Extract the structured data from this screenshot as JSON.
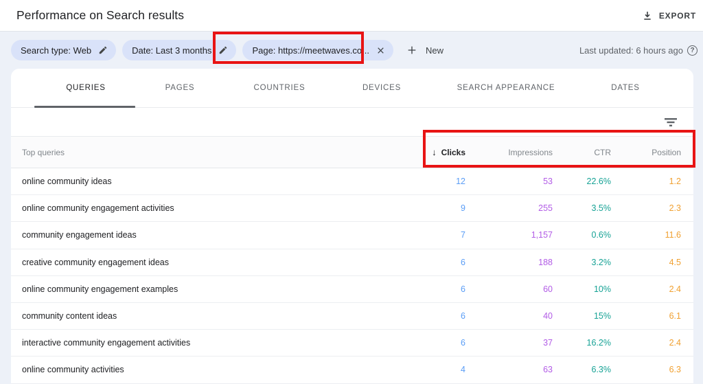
{
  "topbar": {
    "title": "Performance on Search results",
    "export_label": "EXPORT"
  },
  "filter_bar": {
    "chip_search_type": "Search type: Web",
    "chip_date": "Date: Last 3 months",
    "chip_page": "Page: https://meetwaves.co...",
    "new_label": "New",
    "last_updated": "Last updated: 6 hours ago"
  },
  "tabs": [
    {
      "label": "QUERIES",
      "active": true
    },
    {
      "label": "PAGES",
      "active": false
    },
    {
      "label": "COUNTRIES",
      "active": false
    },
    {
      "label": "DEVICES",
      "active": false
    },
    {
      "label": "SEARCH APPEARANCE",
      "active": false
    },
    {
      "label": "DATES",
      "active": false
    }
  ],
  "table": {
    "first_col_header": "Top queries",
    "sort_arrow": "↓",
    "sorted_column": "Clicks",
    "columns": [
      {
        "label": "Clicks"
      },
      {
        "label": "Impressions"
      },
      {
        "label": "CTR"
      },
      {
        "label": "Position"
      }
    ],
    "rows": [
      {
        "query": "online community ideas",
        "clicks": "12",
        "impressions": "53",
        "ctr": "22.6%",
        "position": "1.2"
      },
      {
        "query": "online community engagement activities",
        "clicks": "9",
        "impressions": "255",
        "ctr": "3.5%",
        "position": "2.3"
      },
      {
        "query": "community engagement ideas",
        "clicks": "7",
        "impressions": "1,157",
        "ctr": "0.6%",
        "position": "11.6"
      },
      {
        "query": "creative community engagement ideas",
        "clicks": "6",
        "impressions": "188",
        "ctr": "3.2%",
        "position": "4.5"
      },
      {
        "query": "online community engagement examples",
        "clicks": "6",
        "impressions": "60",
        "ctr": "10%",
        "position": "2.4"
      },
      {
        "query": "community content ideas",
        "clicks": "6",
        "impressions": "40",
        "ctr": "15%",
        "position": "6.1"
      },
      {
        "query": "interactive community engagement activities",
        "clicks": "6",
        "impressions": "37",
        "ctr": "16.2%",
        "position": "2.4"
      },
      {
        "query": "online community activities",
        "clicks": "4",
        "impressions": "63",
        "ctr": "6.3%",
        "position": "6.3"
      }
    ]
  },
  "colors": {
    "clicks": "#5a9df6",
    "impressions": "#b25ce6",
    "ctr": "#16a295",
    "position": "#f0a030",
    "annotation": "#e81414",
    "chip_bg": "#d9e2f9",
    "page_bg": "#edf1f8"
  }
}
